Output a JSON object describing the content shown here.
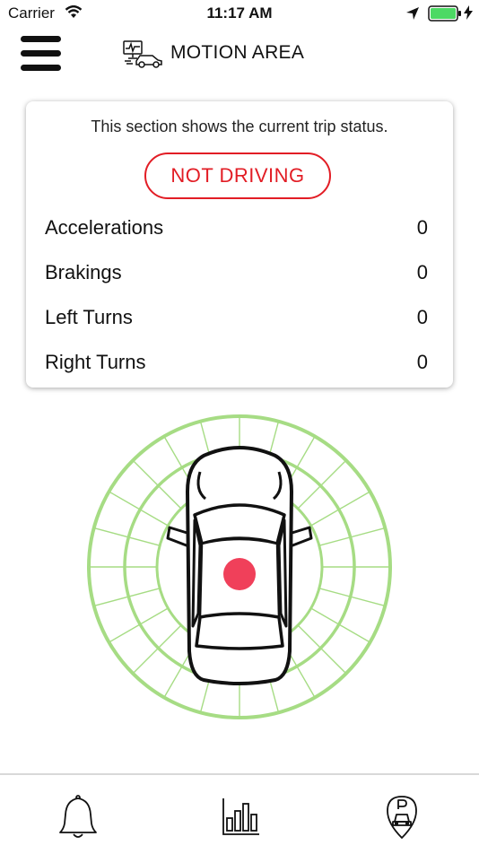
{
  "status_bar": {
    "carrier": "Carrier",
    "time": "11:17 AM",
    "icons": [
      "wifi-icon",
      "location-arrow-icon",
      "battery-icon",
      "charging-bolt-icon"
    ],
    "battery_color": "#4cd964"
  },
  "nav": {
    "title": "MOTION AREA",
    "menu_icon": "hamburger-menu-icon",
    "title_icon": "car-monitor-icon"
  },
  "card": {
    "description": "This section shows the current trip status.",
    "status": "NOT DRIVING",
    "status_color": "#e21d25",
    "stats": [
      {
        "label": "Accelerations",
        "value": "0"
      },
      {
        "label": "Brakings",
        "value": "0"
      },
      {
        "label": "Left Turns",
        "value": "0"
      },
      {
        "label": "Right Turns",
        "value": "0"
      }
    ]
  },
  "radar": {
    "ring_color": "#a6dc84",
    "indicator_color": "#f0405a",
    "icon": "car-top-view-icon"
  },
  "tabs": [
    {
      "icon": "bell-icon"
    },
    {
      "icon": "bar-chart-icon"
    },
    {
      "icon": "parking-location-icon"
    }
  ]
}
